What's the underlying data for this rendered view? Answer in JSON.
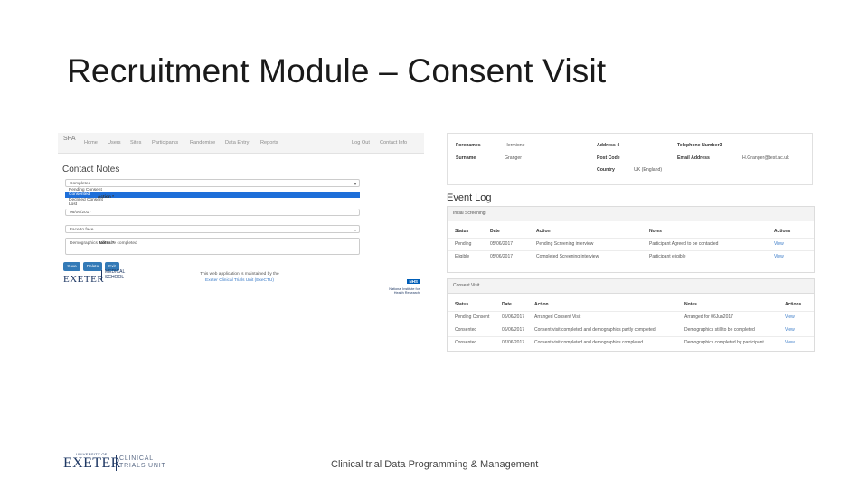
{
  "slide": {
    "title": "Recruitment Module – Consent Visit",
    "footer_text": "Clinical trial Data Programming & Management"
  },
  "left": {
    "nav": {
      "brand": "SPA",
      "items": [
        "Home",
        "Users",
        "Sites",
        "Participants",
        "Randomise",
        "Data Entry",
        "Reports"
      ],
      "right_items": [
        "Log Out",
        "Contact Info"
      ]
    },
    "contact_notes_title": "Contact Notes",
    "form": {
      "status_label": "Status *",
      "status_value": "Completed",
      "status_options": [
        "Pending Consent",
        "Consented",
        "Declined Consent",
        "Lost"
      ],
      "status_selected_index": 1,
      "action_label": "Action *",
      "date_label": "Date*",
      "date_value": "06/06/2017",
      "contact_method_label": "Contact Method*",
      "contact_method_value": "Face to face",
      "notes_label": "Notes *",
      "notes_value": "Demographics still to be completed"
    },
    "buttons": {
      "save": "Save",
      "delete": "Delete",
      "exit": "Exit"
    },
    "footer": {
      "logo_word": "EXETER",
      "logo_med": [
        "MEDICAL",
        "SCHOOL"
      ],
      "maintained_line": "This web application is maintained by the",
      "maintained_link": "Exeter Clinical Trials Unit (ExeCTU)",
      "nhs": "NHS",
      "nihr_lines": [
        "National Institute for",
        "Health Research"
      ]
    }
  },
  "right": {
    "participant": {
      "forenames_label": "Forenames",
      "forenames_value": "Hermione",
      "surname_label": "Surname",
      "surname_value": "Granger",
      "address4_label": "Address 4",
      "postcode_label": "Post Code",
      "country_label": "Country",
      "country_value": "UK (England)",
      "telephone_label": "Telephone Number3",
      "email_label": "Email Address",
      "email_value": "H.Granger@test.ac.uk"
    },
    "event_log_title": "Event Log",
    "initial_screening": {
      "heading": "Initial Screening",
      "columns": [
        "Status",
        "Date",
        "Action",
        "Notes",
        "Actions"
      ],
      "rows": [
        [
          "Pending",
          "05/06/2017",
          "Pending Screening interview",
          "Participant Agreed to be contacted",
          "View"
        ],
        [
          "Eligible",
          "05/06/2017",
          "Completed Screening interview",
          "Participant eligible",
          "View"
        ]
      ]
    },
    "consent_visit": {
      "heading": "Consent Visit",
      "columns": [
        "Status",
        "Date",
        "Action",
        "Notes",
        "Actions"
      ],
      "rows": [
        [
          "Pending Consent",
          "05/06/2017",
          "Arranged Consent Visit",
          "Arranged for 06Jun2017",
          "View"
        ],
        [
          "Consented",
          "06/06/2017",
          "Consent visit completed and demographics partly completed",
          "Demographics still to be completed",
          "View"
        ],
        [
          "Consented",
          "07/06/2017",
          "Consent visit completed and demographics completed",
          "Demographics completed by participant",
          "View"
        ]
      ]
    }
  },
  "footer_logo": {
    "uni_of": "UNIVERSITY OF",
    "exeter": "EXETER",
    "ctu": [
      "CLINICAL",
      "TRIALS UNIT"
    ]
  },
  "colors": {
    "link": "#3a7bc8",
    "button": "#337ab7",
    "selected_option": "#1e6fd9",
    "brand_navy": "#1f3864"
  }
}
